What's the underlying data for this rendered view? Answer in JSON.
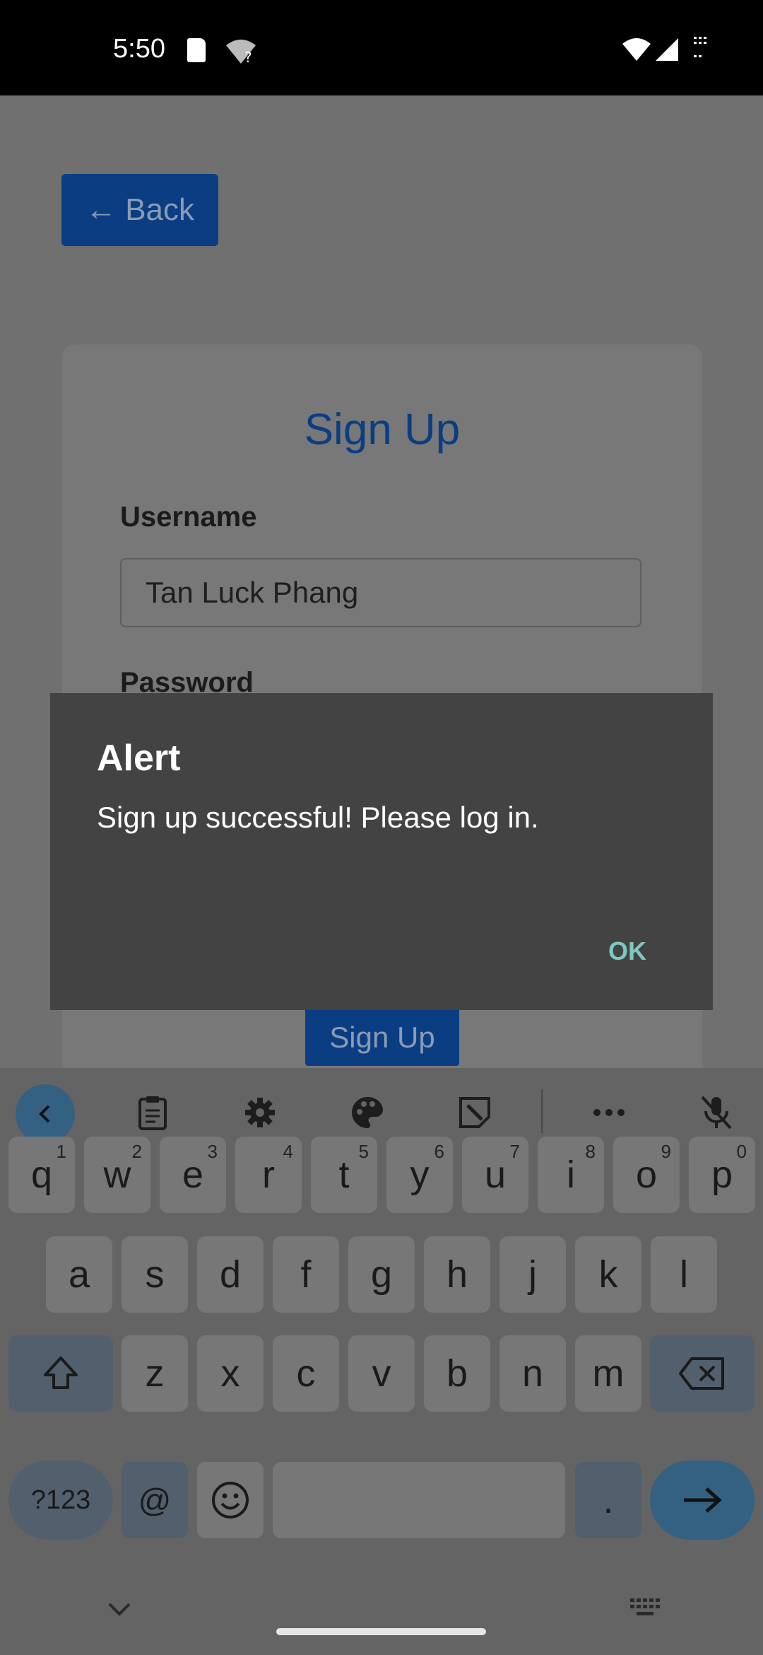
{
  "status_bar": {
    "time": "5:50"
  },
  "app": {
    "back_label": "← Back",
    "card_title": "Sign Up",
    "username_label": "Username",
    "username_value": "Tan Luck Phang",
    "password_label": "Password",
    "submit_label": "Sign Up"
  },
  "dialog": {
    "title": "Alert",
    "message": "Sign up successful! Please log in.",
    "ok_label": "OK"
  },
  "keyboard": {
    "toolbar_icons": [
      "back-arrow-icon",
      "clipboard-icon",
      "gear-icon",
      "palette-icon",
      "sticker-icon",
      "more-icon",
      "mic-off-icon"
    ],
    "row1": [
      "q",
      "w",
      "e",
      "r",
      "t",
      "y",
      "u",
      "i",
      "o",
      "p"
    ],
    "row1_hints": [
      "1",
      "2",
      "3",
      "4",
      "5",
      "6",
      "7",
      "8",
      "9",
      "0"
    ],
    "row2": [
      "a",
      "s",
      "d",
      "f",
      "g",
      "h",
      "j",
      "k",
      "l"
    ],
    "row3": [
      "z",
      "x",
      "c",
      "v",
      "b",
      "n",
      "m"
    ],
    "symbols_label": "?123",
    "at_label": "@",
    "period_label": "."
  }
}
